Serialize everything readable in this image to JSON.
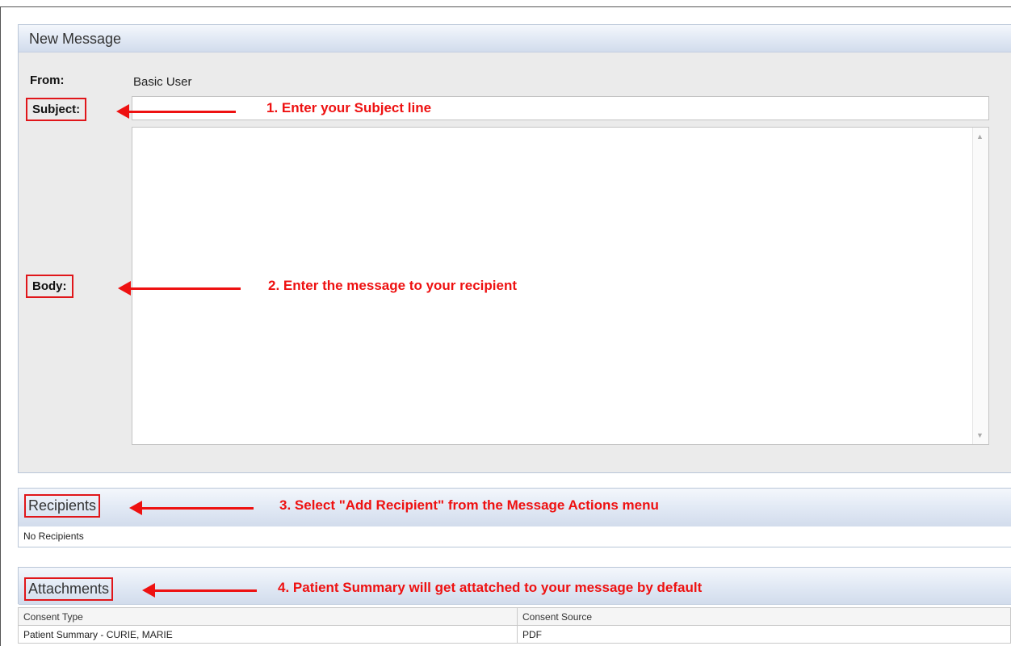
{
  "message": {
    "title": "New Message",
    "from_label": "From:",
    "from_value": "Basic User",
    "subject_label": "Subject:",
    "subject_value": "",
    "body_label": "Body:",
    "body_value": ""
  },
  "recipients": {
    "title": "Recipients",
    "empty_text": "No Recipients"
  },
  "attachments": {
    "title": "Attachments",
    "columns": [
      "Consent Type",
      "Consent Source"
    ],
    "rows": [
      [
        "Patient Summary - CURIE, MARIE",
        "PDF"
      ]
    ]
  },
  "annotations": {
    "step1": "1. Enter your Subject line",
    "step2": "2. Enter the message to your recipient",
    "step3": "3. Select \"Add Recipient\" from the Message Actions menu",
    "step4": "4. Patient Summary will get attatched to your message by default"
  },
  "colors": {
    "annotation": "#ee1111",
    "header_gradient_top": "#f4f7fc",
    "header_gradient_bottom": "#d2dcec"
  }
}
